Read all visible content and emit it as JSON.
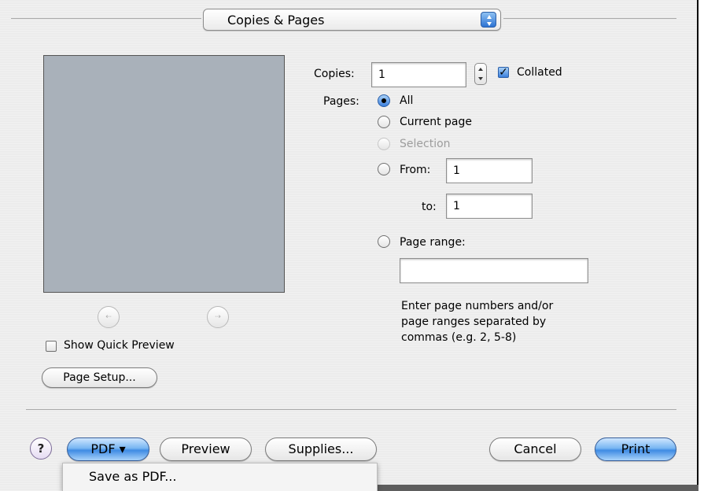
{
  "dialog": {
    "section_popup": {
      "selected": "Copies & Pages"
    },
    "copies": {
      "label": "Copies:",
      "value": "1",
      "collated_label": "Collated",
      "collated_checked": true
    },
    "pages": {
      "label": "Pages:",
      "options": {
        "all": "All",
        "current_page": "Current page",
        "selection": "Selection",
        "from": "From:",
        "to": "to:",
        "page_range": "Page range:"
      },
      "selected": "all",
      "from_value": "1",
      "to_value": "1",
      "page_range_value": "",
      "hint_lines": [
        "Enter page numbers and/or",
        "page ranges separated by",
        "commas (e.g. 2, 5-8)"
      ]
    },
    "preview": {
      "show_quick_preview_label": "Show Quick Preview",
      "show_quick_preview_checked": false,
      "page_setup_label": "Page Setup..."
    },
    "buttons": {
      "help": "?",
      "pdf": "PDF ▾",
      "preview": "Preview",
      "supplies": "Supplies...",
      "cancel": "Cancel",
      "print": "Print"
    },
    "pdf_menu": {
      "items": [
        "Save as PDF..."
      ]
    }
  },
  "colors": {
    "accent": "#3f8be3",
    "preview_fill": "#a9b1ba",
    "panel_bg": "#ececec"
  }
}
